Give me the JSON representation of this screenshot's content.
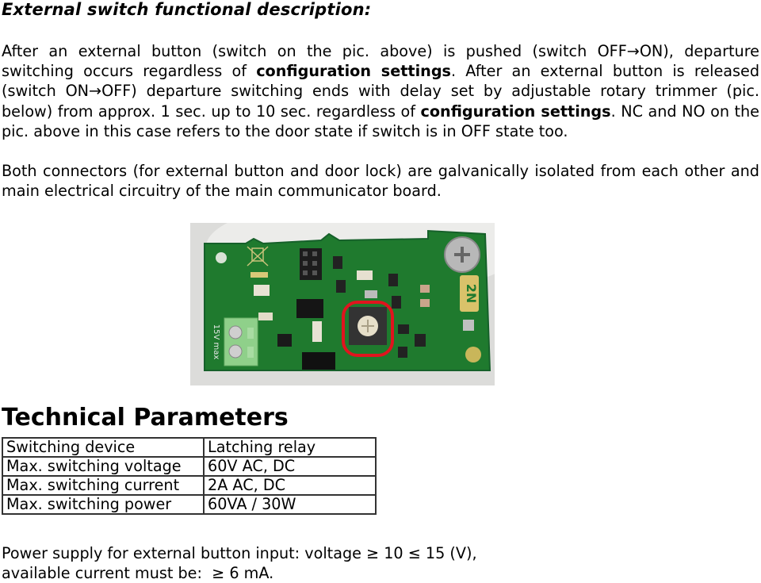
{
  "section_heading": "External switch functional description:",
  "paragraph1": {
    "part1": "After an external button (switch on the pic. above) is pushed (switch OFF→ON), departure switching occurs regardless of ",
    "bold1": "configuration settings",
    "part2": ". After an external button is released (switch ON→OFF) departure switching ends with delay set by adjustable rotary trimmer (pic. below) from approx. 1 sec. up to 10 sec. regardless of ",
    "bold2": "configuration settings",
    "part3": ". NC and NO on the pic. above in this case refers to the door state if switch is in OFF state too."
  },
  "paragraph2": "Both connectors (for external button and door lock) are galvanically isolated from each other and main electrical circuitry of the main communicator board.",
  "photo": {
    "description": "PCB board photo with rotary trimmer highlighted by red circle",
    "label_voltage": "15V max",
    "logo": "2N",
    "colors": {
      "pcb": "#1f7a2e",
      "highlight": "#e0141e",
      "terminal": "#8fd08a",
      "background": "#d8d8d6"
    }
  },
  "tech_heading": "Technical Parameters",
  "tech_table": [
    {
      "param": "Switching device",
      "value": "Latching relay"
    },
    {
      "param": "Max. switching voltage",
      "value": "60V AC, DC"
    },
    {
      "param": "Max. switching current",
      "value": "2A AC, DC"
    },
    {
      "param": "Max. switching power",
      "value": "60VA / 30W"
    }
  ],
  "footer": {
    "line1": "Power supply for external button input: voltage ≥ 10 ≤ 15 (V),",
    "line2": "available current must be:  ≥ 6 mA."
  }
}
